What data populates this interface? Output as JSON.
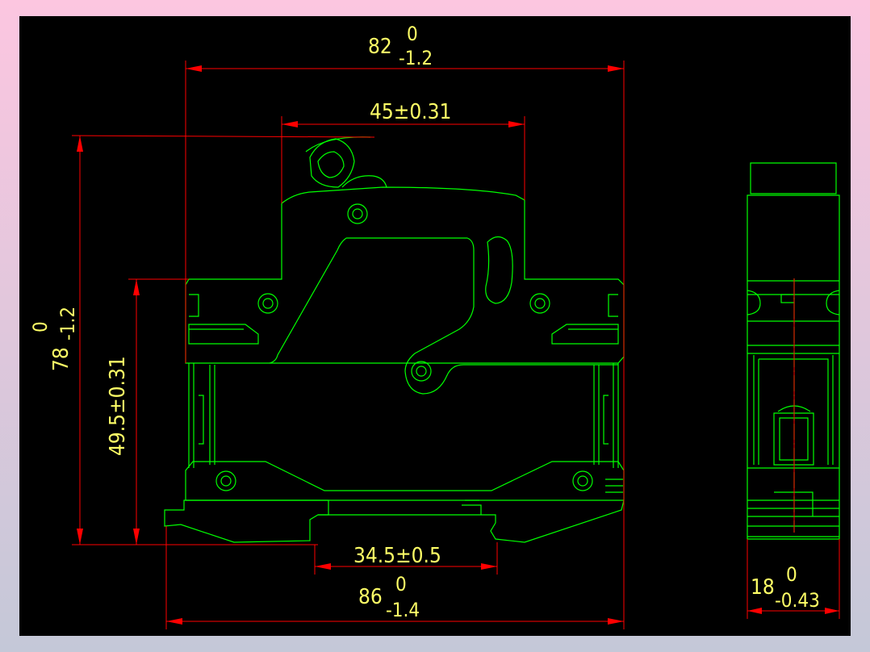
{
  "colors": {
    "background": "#000000",
    "outline": "#00ff00",
    "dimension_line": "#ff0000",
    "dimension_text": "#ffff66",
    "frame_top": "#fcc6e0",
    "frame_bottom": "#c4c8d8"
  },
  "dimensions": {
    "top_width": {
      "value": "82",
      "upper": "0",
      "lower": "-1.2"
    },
    "inner_width": {
      "value": "45±0.31"
    },
    "total_height": {
      "value": "78",
      "upper": "0",
      "lower": "-1.2"
    },
    "rail_height": {
      "value": "49.5±0.31"
    },
    "rail_width": {
      "value": "34.5±0.5"
    },
    "bottom_width": {
      "value": "86",
      "upper": "0",
      "lower": "-1.4"
    },
    "side_width": {
      "value": "18",
      "upper": "0",
      "lower": "-0.43"
    }
  }
}
